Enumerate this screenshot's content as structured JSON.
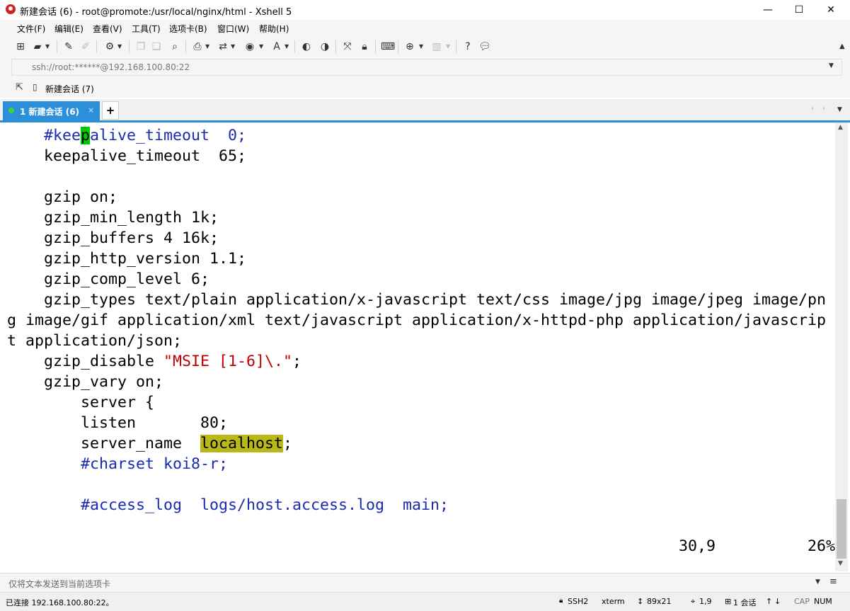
{
  "window": {
    "title": "新建会话 (6) - root@promote:/usr/local/nginx/html - Xshell 5",
    "controls": {
      "minimize": "—",
      "maximize": "☐",
      "close": "✕"
    }
  },
  "menu": [
    "文件(F)",
    "编辑(E)",
    "查看(V)",
    "工具(T)",
    "选项卡(B)",
    "窗口(W)",
    "帮助(H)"
  ],
  "address": {
    "value": "ssh://root:******@192.168.100.80:22"
  },
  "session_bar": {
    "label": "新建会话 (7)"
  },
  "tabs": [
    {
      "label": "1 新建会话 (6)",
      "close": "×",
      "status_color": "#3fd23f"
    }
  ],
  "new_tab": "+",
  "terminal": {
    "lines": [
      [
        {
          "t": "    "
        },
        {
          "t": "#kee",
          "c": "cmt"
        },
        {
          "t": "p",
          "c": "cur"
        },
        {
          "t": "alive_timeout  0;",
          "c": "cmt"
        }
      ],
      [
        {
          "t": "    keepalive_timeout  65;"
        }
      ],
      [
        {
          "t": ""
        }
      ],
      [
        {
          "t": "    gzip on;"
        }
      ],
      [
        {
          "t": "    gzip_min_length 1k;"
        }
      ],
      [
        {
          "t": "    gzip_buffers 4 16k;"
        }
      ],
      [
        {
          "t": "    gzip_http_version 1.1;"
        }
      ],
      [
        {
          "t": "    gzip_comp_level 6;"
        }
      ],
      [
        {
          "t": "    gzip_types text/plain application/x-javascript text/css image/jpg image/jpeg image/pn"
        }
      ],
      [
        {
          "t": "g image/gif application/xml text/javascript application/x-httpd-php application/javascrip"
        }
      ],
      [
        {
          "t": "t application/json;"
        }
      ],
      [
        {
          "t": "    gzip_disable "
        },
        {
          "t": "\"MSIE [1-6]\\.\"",
          "c": "str"
        },
        {
          "t": ";"
        }
      ],
      [
        {
          "t": "    gzip_vary on;"
        }
      ],
      [
        {
          "t": "        server {"
        }
      ],
      [
        {
          "t": "        listen       80;"
        }
      ],
      [
        {
          "t": "        server_name  "
        },
        {
          "t": "localhost",
          "c": "hl"
        },
        {
          "t": ";"
        }
      ],
      [
        {
          "t": "        "
        },
        {
          "t": "#charset koi8-r;",
          "c": "cmt"
        }
      ],
      [
        {
          "t": ""
        }
      ],
      [
        {
          "t": "        "
        },
        {
          "t": "#access_log  logs/host.access.log  main;",
          "c": "cmt"
        }
      ],
      [
        {
          "t": ""
        }
      ],
      [
        {
          "t": "                                                                         30,9          26%"
        }
      ]
    ]
  },
  "compose": {
    "placeholder": "仅将文本发送到当前选项卡"
  },
  "status": {
    "connection": "已连接 192.168.100.80:22。",
    "protocol": "SSH2",
    "terminal_type": "xterm",
    "size": "89x21",
    "position": "1,9",
    "sessions": "1 会话",
    "caps": "CAP",
    "num": "NUM"
  },
  "colors": {
    "accent": "#2b90d9",
    "comment": "#1a2bb0",
    "string": "#c00000",
    "highlight": "#b8b818",
    "cursor": "#00c800"
  }
}
